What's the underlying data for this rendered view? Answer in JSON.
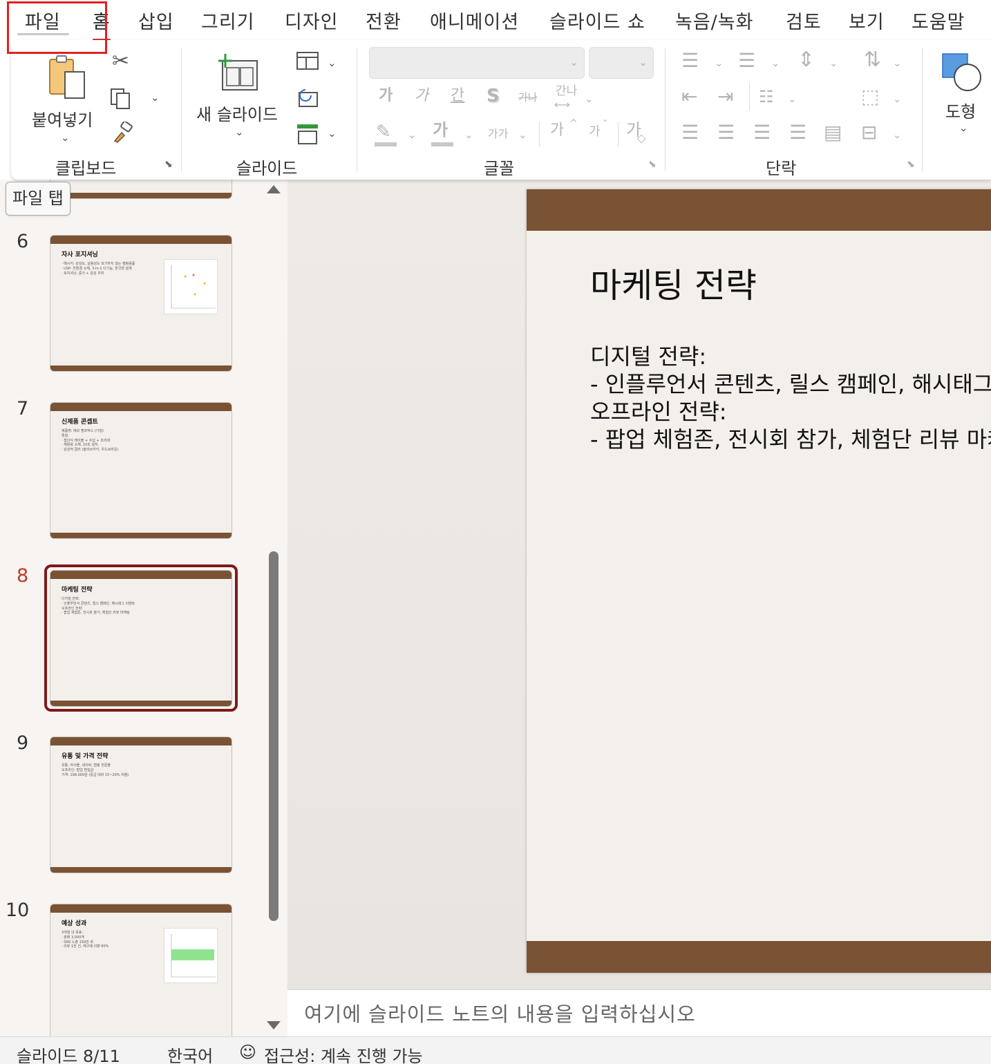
{
  "menu": {
    "tabs": [
      "파일",
      "홈",
      "삽입",
      "그리기",
      "디자인",
      "전환",
      "애니메이션",
      "슬라이드 쇼",
      "녹음/녹화",
      "검토",
      "보기",
      "도움말"
    ],
    "active_tab": "홈",
    "highlighted_tab": "파일"
  },
  "ribbon": {
    "clipboard": {
      "paste_label": "붙여넣기",
      "group_label": "클립보드"
    },
    "slides": {
      "new_slide_label": "새 슬라이드",
      "group_label": "슬라이드"
    },
    "font": {
      "font_name": "",
      "font_size": "",
      "group_label": "글꼴",
      "bold": "가",
      "italic": "가",
      "underline": "간",
      "shadow": "S",
      "strike": "가나",
      "spacing": "간나",
      "highlight": "가",
      "change_case": "가가",
      "grow": "가",
      "shrink": "가",
      "clear": "가"
    },
    "paragraph": {
      "group_label": "단락"
    },
    "drawing": {
      "shapes_label": "도형"
    }
  },
  "tooltip": "파일 탭",
  "thumbnails": [
    {
      "number": "6",
      "title": "자사 포지셔닝",
      "body": "· 메시지: 감성도, 실용성도 포기하지 않는 캠핑용품\n· USP: 친환경 소재, 3-in-1 다기능, 한국형 설계\n· 포지셔닝: 중가 + 감성 우위",
      "selected": false
    },
    {
      "number": "7",
      "title": "신제품 콘셉트",
      "body": "제품명: 에코 캠프박스 (가칭)\n특징:\n· 접이식 테이블 + 수납 + 조리대\n· 재활용 소재, 10초 설치\n· 감성적 컬러 (올리브카키, 우드브라운)",
      "selected": false
    },
    {
      "number": "8",
      "title": "마케팅 전략",
      "body": "디지털 전략:\n· 인플루언서 콘텐츠, 릴스 캠페인, 해시태그 이벤트\n오프라인 전략:\n· 팝업 체험존, 전시회 참가, 체험단 리뷰 마케팅",
      "selected": true
    },
    {
      "number": "9",
      "title": "유통 및 가격 전략",
      "body": "유통: 자사몰, 네이버, 캠핑 전문몰\n오프라인: 팝업 편집샵\n가격: 198,000원 (중급 대비 15~20% 저렴)",
      "selected": false
    },
    {
      "number": "10",
      "title": "예상 성과",
      "body": "3개월 내 목표:\n· 판매 3,000개\n· SNS 노출 150만 회\n· 리뷰 1천 건, 재구매 의향 80%",
      "selected": false
    }
  ],
  "slide": {
    "title": "마케팅 전략",
    "body": "디지털 전략:\n- 인플루언서 콘텐츠, 릴스 캠페인, 해시태그 이벤트\n오프라인 전략:\n- 팝업 체험존, 전시회 참가, 체험단 리뷰 마케팅",
    "accent_color": "#7a5234",
    "background_color": "#f3efea"
  },
  "notes_placeholder": "여기에 슬라이드 노트의 내용을 입력하십시오",
  "status": {
    "slide_counter": "슬라이드 8/11",
    "language": "한국어",
    "accessibility": "접근성: 계속 진행 가능"
  }
}
